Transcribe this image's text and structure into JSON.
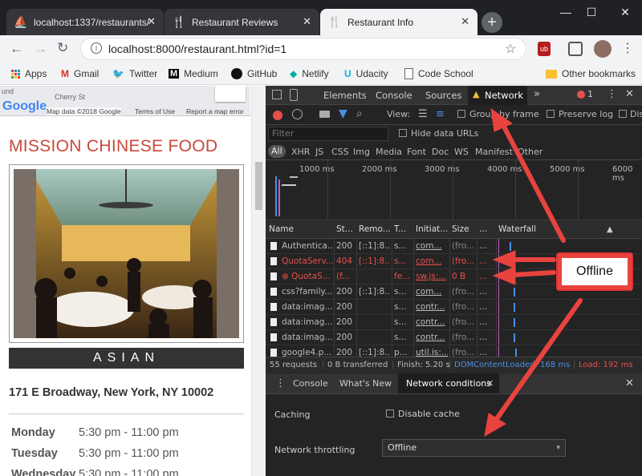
{
  "browser": {
    "tabs": [
      {
        "title": "localhost:1337/restaurants/"
      },
      {
        "title": "Restaurant Reviews"
      },
      {
        "title": "Restaurant Info"
      }
    ],
    "new_tab": "+",
    "window": {
      "minimize": "—",
      "maximize": "☐",
      "close": "✕"
    },
    "url": "localhost:8000/restaurant.html?id=1",
    "bookmarks": [
      "Apps",
      "Gmail",
      "Twitter",
      "Medium",
      "GitHub",
      "Netlify",
      "Udacity",
      "Code School"
    ],
    "other_bookmarks": "Other bookmarks"
  },
  "page": {
    "map": {
      "street": "Cherry St",
      "street2": "und",
      "logo": "Google",
      "data": "Map data ©2018 Google",
      "terms": "Terms of Use",
      "report": "Report a map error"
    },
    "restaurant_name": "MISSION CHINESE FOOD",
    "cuisine": "ASIAN",
    "address": "171 E Broadway, New York, NY 10002",
    "hours": [
      {
        "day": "Monday",
        "time": "5:30 pm - 11:00 pm"
      },
      {
        "day": "Tuesday",
        "time": "5:30 pm - 11:00 pm"
      },
      {
        "day": "Wednesday",
        "time": "5:30 pm - 11:00 pm"
      }
    ]
  },
  "devtools": {
    "tabs": [
      "Elements",
      "Console",
      "Sources",
      "Network"
    ],
    "active_tab": "Network",
    "more": "»",
    "error_count": "1",
    "view_label": "View:",
    "group_by_frame": "Group by frame",
    "preserve_log": "Preserve log",
    "disable_cache_cut": "Dis",
    "filter_placeholder": "Filter",
    "hide_data_urls": "Hide data URLs",
    "filter_types": [
      "All",
      "XHR",
      "JS",
      "CSS",
      "Img",
      "Media",
      "Font",
      "Doc",
      "WS",
      "Manifest",
      "Other"
    ],
    "timeline_ticks": [
      "1000 ms",
      "2000 ms",
      "3000 ms",
      "4000 ms",
      "5000 ms",
      "6000 ms"
    ],
    "columns": [
      "Name",
      "St...",
      "Remo...",
      "T...",
      "Initiat...",
      "Size",
      "...",
      "Waterfall"
    ],
    "requests": [
      {
        "name": "Authentica...",
        "status": "200",
        "remote": "[::1]:8...",
        "type": "s...",
        "initiator": "com...",
        "size": "(fro...",
        "more": "...",
        "error": false
      },
      {
        "name": "QuotaServ...",
        "status": "404",
        "remote": "[::1]:8...",
        "type": "s...",
        "initiator": "com...",
        "size": "(fro...",
        "more": "...",
        "error": true
      },
      {
        "name": "⊗ QuotaS...",
        "status": "(f...",
        "remote": "",
        "type": "fe...",
        "initiator": "sw.js:...",
        "size": "0 B",
        "more": "...",
        "error": true
      },
      {
        "name": "css?family...",
        "status": "200",
        "remote": "[::1]:8...",
        "type": "s...",
        "initiator": "com...",
        "size": "(fro...",
        "more": "...",
        "error": false
      },
      {
        "name": "data:imag...",
        "status": "200",
        "remote": "",
        "type": "s...",
        "initiator": "contr...",
        "size": "(fro...",
        "more": "...",
        "error": false
      },
      {
        "name": "data:imag...",
        "status": "200",
        "remote": "",
        "type": "s...",
        "initiator": "contr...",
        "size": "(fro...",
        "more": "...",
        "error": false
      },
      {
        "name": "data:imag...",
        "status": "200",
        "remote": "",
        "type": "s...",
        "initiator": "contr...",
        "size": "(fro...",
        "more": "...",
        "error": false
      },
      {
        "name": "google4.p...",
        "status": "200",
        "remote": "[::1]:8...",
        "type": "p...",
        "initiator": "util.is:...",
        "size": "(fro...",
        "more": "...",
        "error": false
      }
    ],
    "status_bar": {
      "requests": "55 requests",
      "transferred": "0 B transferred",
      "finish": "Finish: 5.20 s",
      "dom": "DOMContentLoaded: 168 ms",
      "load": "Load: 192 ms"
    },
    "drawer_tabs": [
      "Console",
      "What's New",
      "Network conditions"
    ],
    "caching_label": "Caching",
    "disable_cache": "Disable cache",
    "throttling_label": "Network throttling",
    "throttling_value": "Offline"
  },
  "annotation": {
    "callout": "Offline",
    "color": "#e8433f"
  }
}
